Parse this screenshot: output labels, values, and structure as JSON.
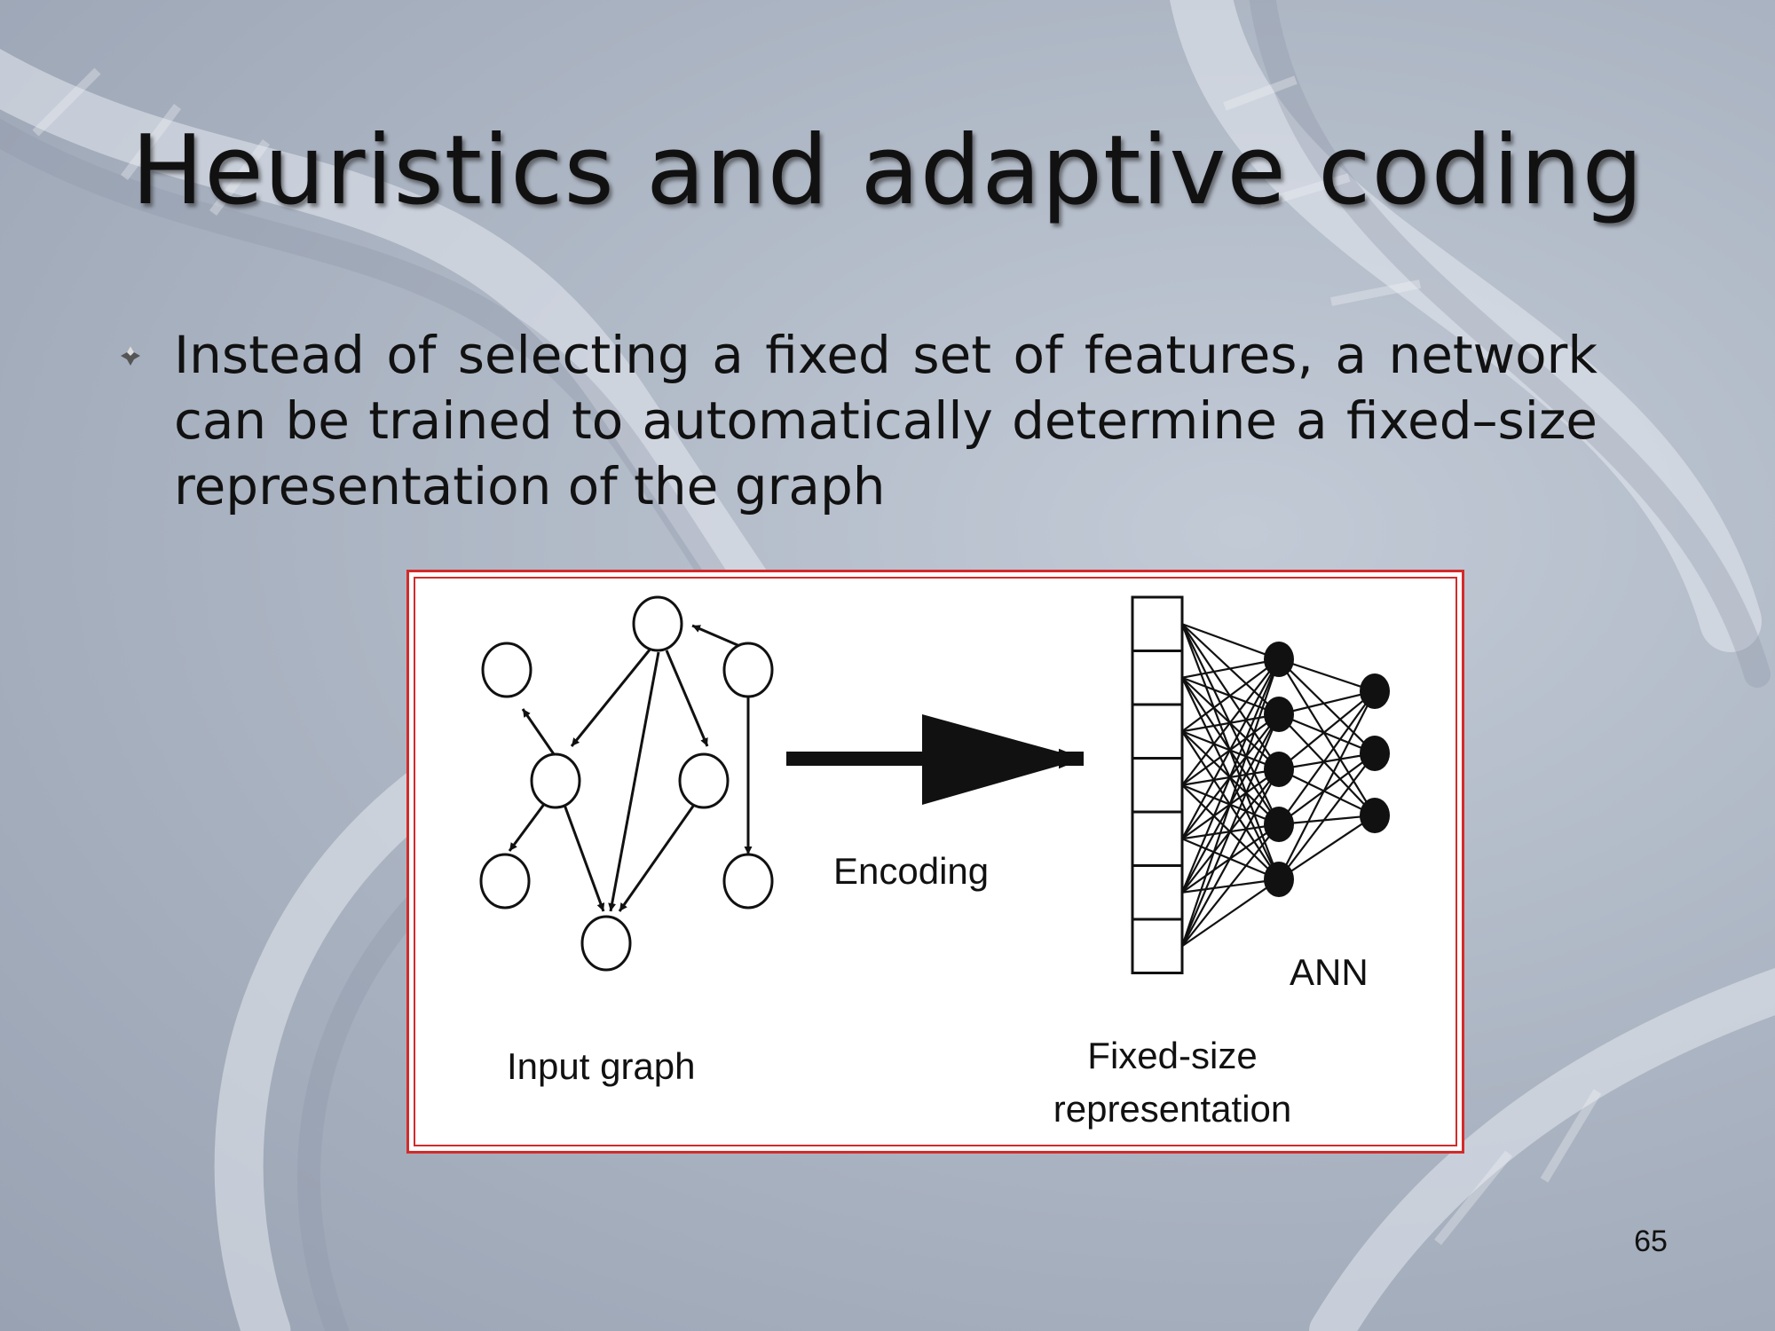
{
  "slide": {
    "title": "Heuristics and adaptive coding",
    "bullet": "Instead of selecting a fixed set of features, a network can be trained to automatically determine a fixed–size representation of the graph",
    "page_number": "65"
  },
  "figure": {
    "encoding_label": "Encoding",
    "ann_label": "ANN",
    "input_graph_label": "Input graph",
    "fixed_size_label_line1": "Fixed-size",
    "fixed_size_label_line2": "representation",
    "input_graph": {
      "nodes": [
        "n1",
        "n2",
        "n3",
        "n4",
        "n5",
        "n6",
        "n7",
        "n8",
        "n9"
      ],
      "edges": [
        [
          "n9",
          "n1"
        ],
        [
          "n1",
          "n4"
        ],
        [
          "n1",
          "n5"
        ],
        [
          "n1",
          "n8"
        ],
        [
          "n4",
          "n2"
        ],
        [
          "n4",
          "n6"
        ],
        [
          "n4",
          "n8"
        ],
        [
          "n5",
          "n8"
        ],
        [
          "n3",
          "n7"
        ]
      ]
    },
    "representation_cells": 7,
    "ann_layers": [
      5,
      3
    ]
  },
  "colors": {
    "frame_border": "#d42a2a",
    "text": "#111111"
  }
}
